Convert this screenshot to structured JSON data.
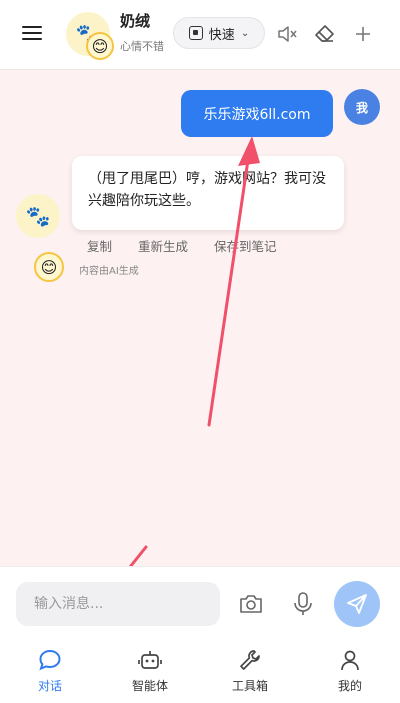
{
  "header": {
    "bot_name": "奶绒",
    "bot_status": "心情不错",
    "avatar_icon": "paw-icon",
    "mood_icon": "smile-icon",
    "mode_label": "快速",
    "icons": [
      "menu-icon",
      "chip-icon",
      "chevron-down-icon",
      "mute-icon",
      "eraser-icon",
      "plus-icon"
    ]
  },
  "messages": {
    "user_avatar_label": "我",
    "user_text": "乐乐游戏6ll.com",
    "bot_text": "（甩了甩尾巴）哼，游戏网站？我可没兴趣陪你玩这些。",
    "actions": [
      "复制",
      "重新生成",
      "保存到笔记"
    ],
    "ai_note": "内容由AI生成"
  },
  "input": {
    "placeholder": "输入消息...",
    "value": ""
  },
  "nav": {
    "items": [
      {
        "label": "对话",
        "icon": "chat-icon",
        "active": true
      },
      {
        "label": "智能体",
        "icon": "robot-icon",
        "active": false
      },
      {
        "label": "工具箱",
        "icon": "wrench-icon",
        "active": false
      },
      {
        "label": "我的",
        "icon": "user-icon",
        "active": false
      }
    ]
  },
  "colors": {
    "accent": "#2f7cf0",
    "background": "#fdf1f1",
    "annotation_arrow": "#f0506a"
  }
}
